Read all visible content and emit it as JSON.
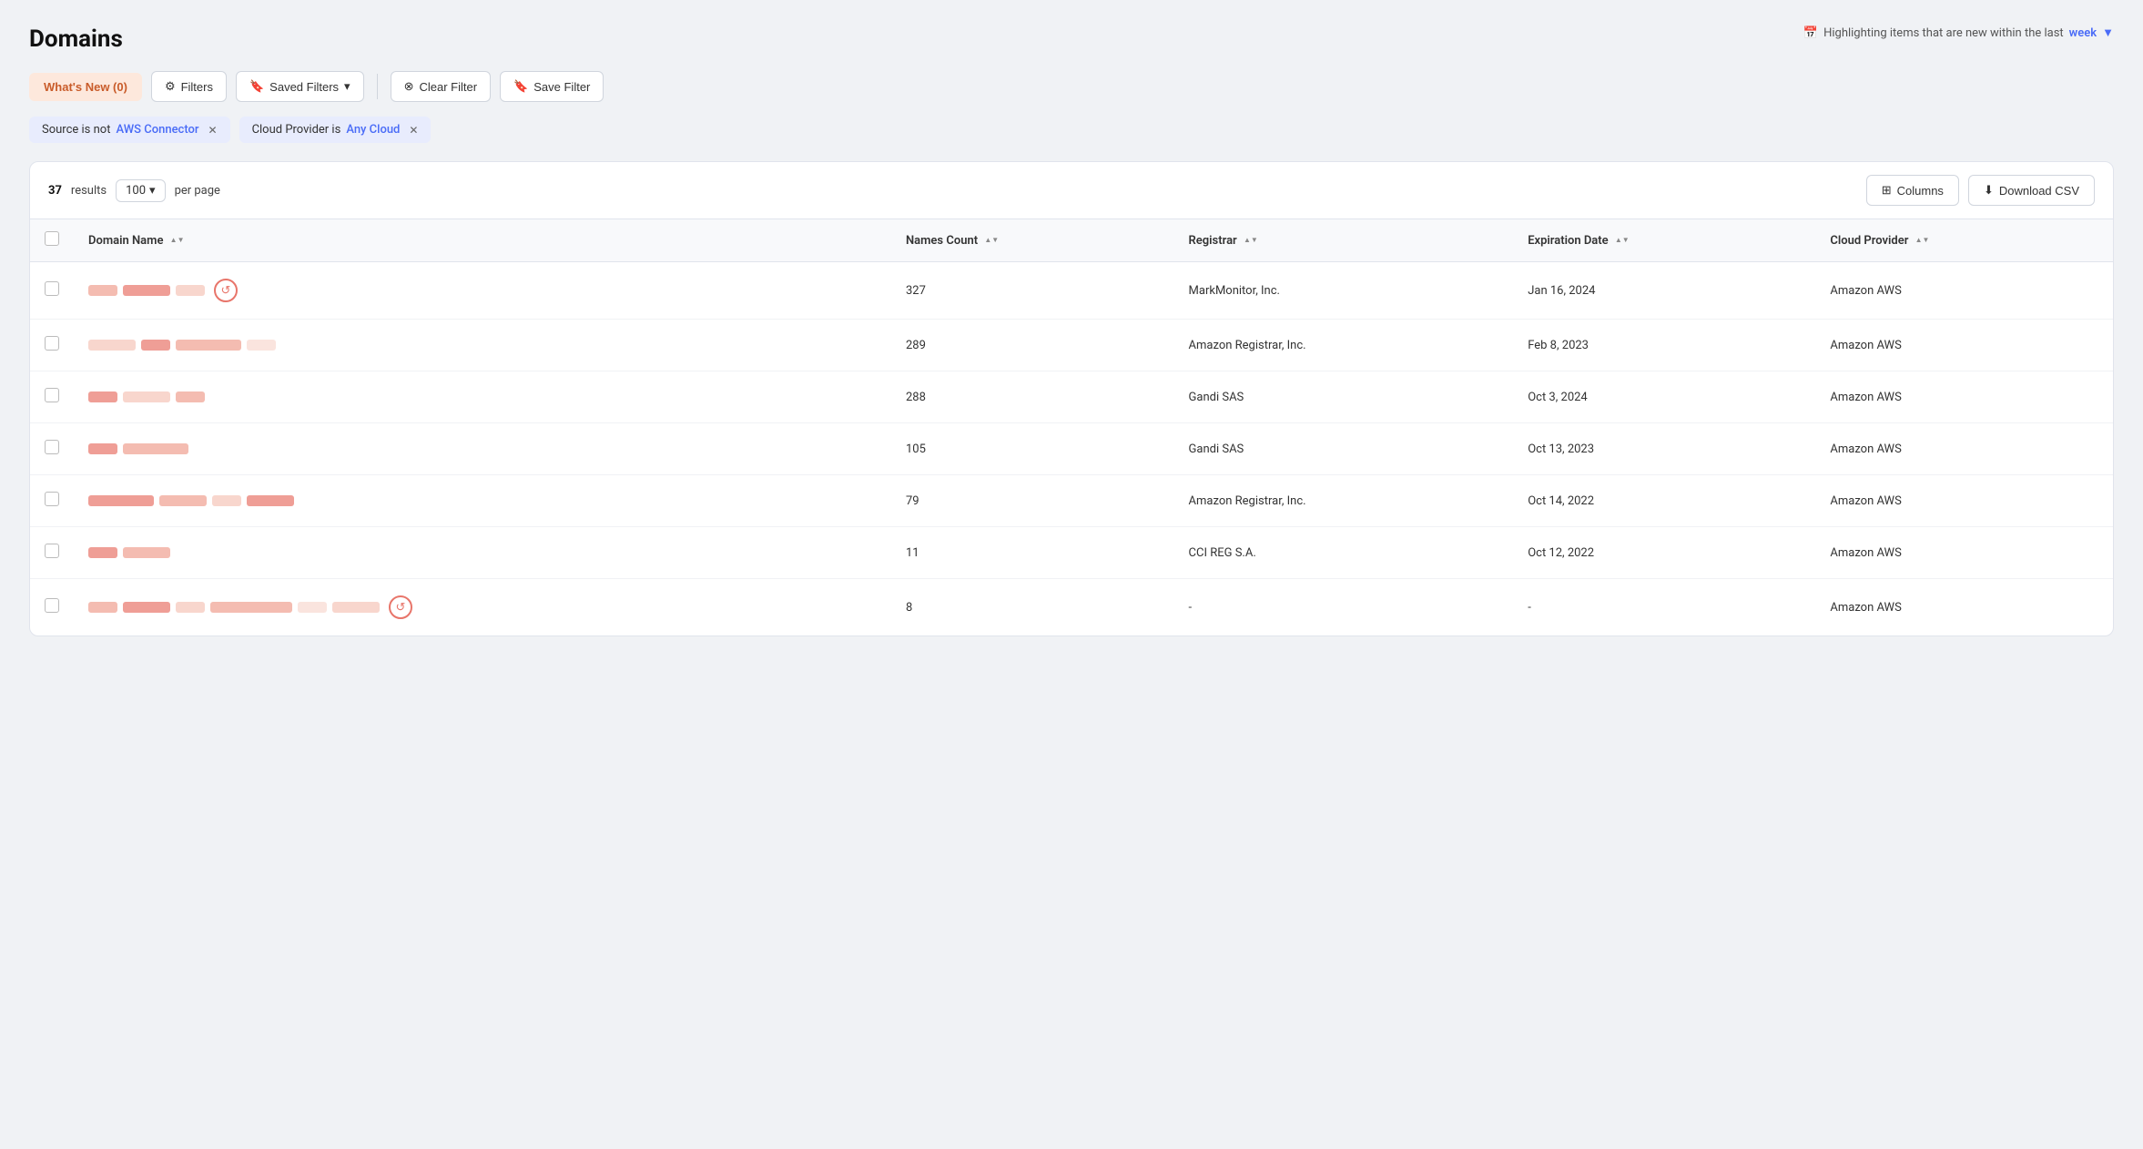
{
  "page": {
    "title": "Domains",
    "highlight_text": "Highlighting items that are new within the last",
    "highlight_period": "week"
  },
  "toolbar": {
    "whats_new_label": "What's New (0)",
    "filters_label": "Filters",
    "saved_filters_label": "Saved Filters",
    "clear_filter_label": "Clear Filter",
    "save_filter_label": "Save Filter"
  },
  "filter_tags": [
    {
      "prefix": "Source is not",
      "value": "AWS Connector",
      "id": "filter-source"
    },
    {
      "prefix": "Cloud Provider is",
      "value": "Any Cloud",
      "id": "filter-cloud"
    }
  ],
  "table": {
    "results_count": "37",
    "per_page": "100",
    "per_page_label": "per page",
    "columns_label": "Columns",
    "download_label": "Download CSV",
    "columns": [
      {
        "key": "domain_name",
        "label": "Domain Name",
        "sortable": true
      },
      {
        "key": "names_count",
        "label": "Names Count",
        "sortable": true
      },
      {
        "key": "registrar",
        "label": "Registrar",
        "sortable": true
      },
      {
        "key": "expiration_date",
        "label": "Expiration Date",
        "sortable": true
      },
      {
        "key": "cloud_provider",
        "label": "Cloud Provider",
        "sortable": true
      }
    ],
    "rows": [
      {
        "names_count": "327",
        "registrar": "MarkMonitor, Inc.",
        "expiration_date": "Jan 16, 2024",
        "cloud_provider": "Amazon AWS",
        "has_icon": true,
        "domain_pattern": "sm-md-sm"
      },
      {
        "names_count": "289",
        "registrar": "Amazon Registrar, Inc.",
        "expiration_date": "Feb 8, 2023",
        "cloud_provider": "Amazon AWS",
        "has_icon": false,
        "domain_pattern": "md-sm-lg-sm"
      },
      {
        "names_count": "288",
        "registrar": "Gandi SAS",
        "expiration_date": "Oct 3, 2024",
        "cloud_provider": "Amazon AWS",
        "has_icon": false,
        "domain_pattern": "sm-md-sm"
      },
      {
        "names_count": "105",
        "registrar": "Gandi SAS",
        "expiration_date": "Oct 13, 2023",
        "cloud_provider": "Amazon AWS",
        "has_icon": false,
        "domain_pattern": "sm-lg"
      },
      {
        "names_count": "79",
        "registrar": "Amazon Registrar, Inc.",
        "expiration_date": "Oct 14, 2022",
        "cloud_provider": "Amazon AWS",
        "has_icon": false,
        "domain_pattern": "lg-md-sm-md"
      },
      {
        "names_count": "11",
        "registrar": "CCI REG S.A.",
        "expiration_date": "Oct 12, 2022",
        "cloud_provider": "Amazon AWS",
        "has_icon": false,
        "domain_pattern": "sm-md"
      },
      {
        "names_count": "8",
        "registrar": "-",
        "expiration_date": "-",
        "cloud_provider": "Amazon AWS",
        "has_icon": true,
        "domain_pattern": "sm-md-sm-xl-sm-md"
      }
    ]
  }
}
